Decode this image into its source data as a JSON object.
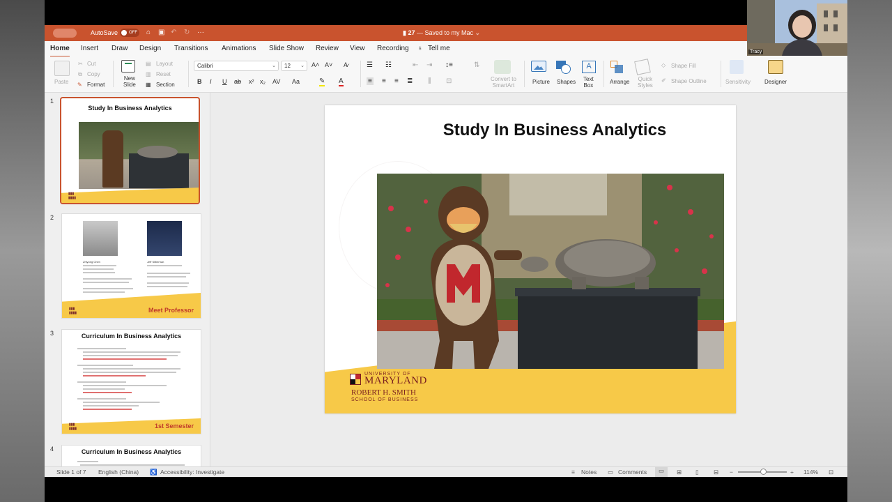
{
  "titlebar": {
    "autosave_label": "AutoSave",
    "autosave_state": "OFF",
    "document_name": "27",
    "saved_status": " — Saved to my Mac",
    "more": "···"
  },
  "tabs": [
    "Home",
    "Insert",
    "Draw",
    "Design",
    "Transitions",
    "Animations",
    "Slide Show",
    "Review",
    "View",
    "Recording",
    "Tell me"
  ],
  "ribbon": {
    "paste": "Paste",
    "cut": "Cut",
    "copy": "Copy",
    "format": "Format",
    "new_slide": "New\nSlide",
    "layout": "Layout",
    "reset": "Reset",
    "section": "Section",
    "font_name": "Calibri",
    "font_size": "12",
    "convert_smartart": "Convert to\nSmartArt",
    "picture": "Picture",
    "shapes": "Shapes",
    "text_box": "Text\nBox",
    "arrange": "Arrange",
    "quick_styles": "Quick\nStyles",
    "shape_fill": "Shape Fill",
    "shape_outline": "Shape Outline",
    "sensitivity": "Sensitivity",
    "designer": "Designer"
  },
  "thumbnails": [
    {
      "num": "1",
      "title": "Study In Business Analytics",
      "tag": ""
    },
    {
      "num": "2",
      "title": "",
      "tag": "Meet Professor",
      "person1": "Zhiyong Chen",
      "person2": "Jeff Silberhan"
    },
    {
      "num": "3",
      "title": "Curriculum In Business Analytics",
      "tag": "1st Semester"
    },
    {
      "num": "4",
      "title": "Curriculum In Business Analytics",
      "tag": ""
    }
  ],
  "slide": {
    "title": "Study In Business Analytics",
    "logo_line1": "UNIVERSITY OF",
    "logo_line2": "MARYLAND",
    "logo_line3": "ROBERT H. SMITH",
    "logo_line4": "SCHOOL OF BUSINESS"
  },
  "status": {
    "slide_of": "Slide 1 of 7",
    "language": "English (China)",
    "accessibility": "Accessibility: Investigate",
    "notes": "Notes",
    "comments": "Comments",
    "zoom": "114%"
  },
  "video": {
    "name": "Tracy"
  },
  "colors": {
    "accent": "#c9532e",
    "brand_gold": "#f7c948",
    "brand_red": "#c0392b"
  }
}
